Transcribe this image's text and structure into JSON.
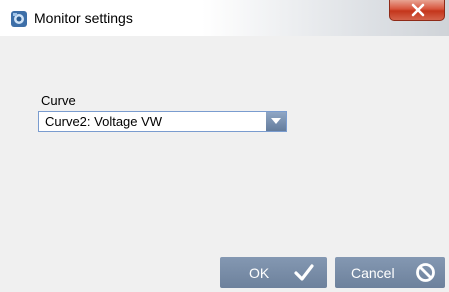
{
  "window": {
    "title": "Monitor settings",
    "icon": "app-icon",
    "close_icon": "close-icon"
  },
  "form": {
    "curve_label": "Curve",
    "curve_value": "Curve2: Voltage VW",
    "dropdown_icon": "chevron-down-icon"
  },
  "buttons": {
    "ok_label": "OK",
    "ok_icon": "checkmark-icon",
    "cancel_label": "Cancel",
    "cancel_icon": "prohibited-icon"
  },
  "colors": {
    "button_bg": "#7a8ea8",
    "close_red": "#c4351b",
    "dialog_bg": "#f0f0f0"
  }
}
